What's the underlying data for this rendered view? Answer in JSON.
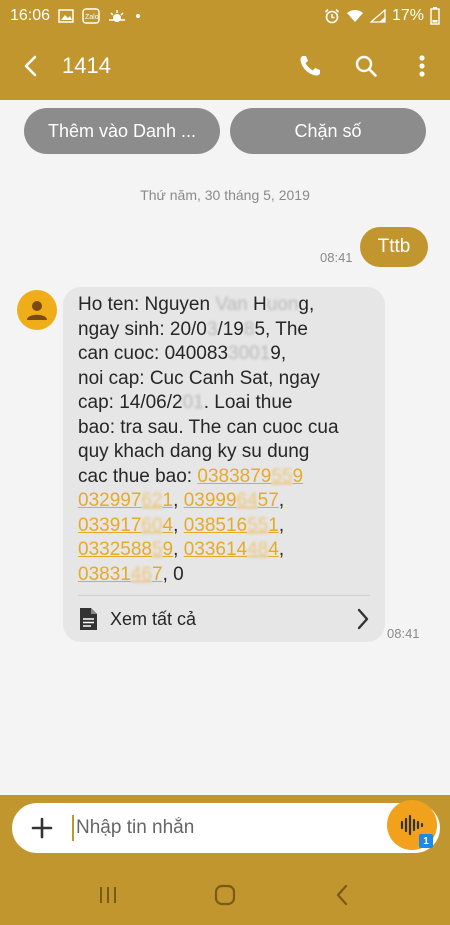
{
  "status_bar": {
    "time": "16:06",
    "battery_percent": "17%",
    "notification_icons": [
      "image-icon",
      "zalo-icon",
      "weather-icon",
      "dot-icon"
    ],
    "system_icons": [
      "alarm-icon",
      "wifi-icon",
      "signal-icon",
      "battery-icon"
    ]
  },
  "header": {
    "title": "1414",
    "back_icon": "back-arrow-icon",
    "actions": [
      "phone-icon",
      "search-icon",
      "more-vert-icon"
    ]
  },
  "actions": {
    "add_contact_label": "Thêm vào Danh ...",
    "block_label": "Chặn số"
  },
  "conversation": {
    "date_separator": "Thứ năm, 30 tháng 5, 2019",
    "outgoing": {
      "text": "Tttb",
      "time": "08:41"
    },
    "incoming": {
      "text_parts": [
        "Ho ten: Nguyen ",
        " H",
        "g,",
        "ngay sinh: 20/0",
        "/19",
        "5, The",
        "can cuoc: 040083",
        "9,",
        "noi cap: Cuc Canh Sat, ngay",
        "cap: 14/06/2",
        ". Loai thue",
        "bao: tra sau. The can cuoc cua",
        "quy khach dang ky su dung",
        "cac thue bao: "
      ],
      "numbers": [
        {
          "start": "0383879",
          "end": "9"
        },
        {
          "start": "032997",
          "end": "1"
        },
        {
          "start": "03999",
          "end": "57"
        },
        {
          "start": "033917",
          "end": "4"
        },
        {
          "start": "038516",
          "end": "1"
        },
        {
          "start": "0332588",
          "end": "9"
        },
        {
          "start": "033614",
          "end": "4"
        },
        {
          "start": "03831",
          "end": "7"
        }
      ],
      "trailing": ", 0",
      "see_all_label": "Xem tất cả",
      "time": "08:41"
    }
  },
  "composer": {
    "placeholder": "Nhập tin nhắn",
    "sim_slot": "1"
  },
  "colors": {
    "accent": "#c1962f",
    "link": "#e7a92a",
    "bubble_in": "#e6e6e6",
    "avatar": "#f0ad1a"
  },
  "navigation": [
    "recent-apps-icon",
    "home-icon",
    "back-icon"
  ]
}
